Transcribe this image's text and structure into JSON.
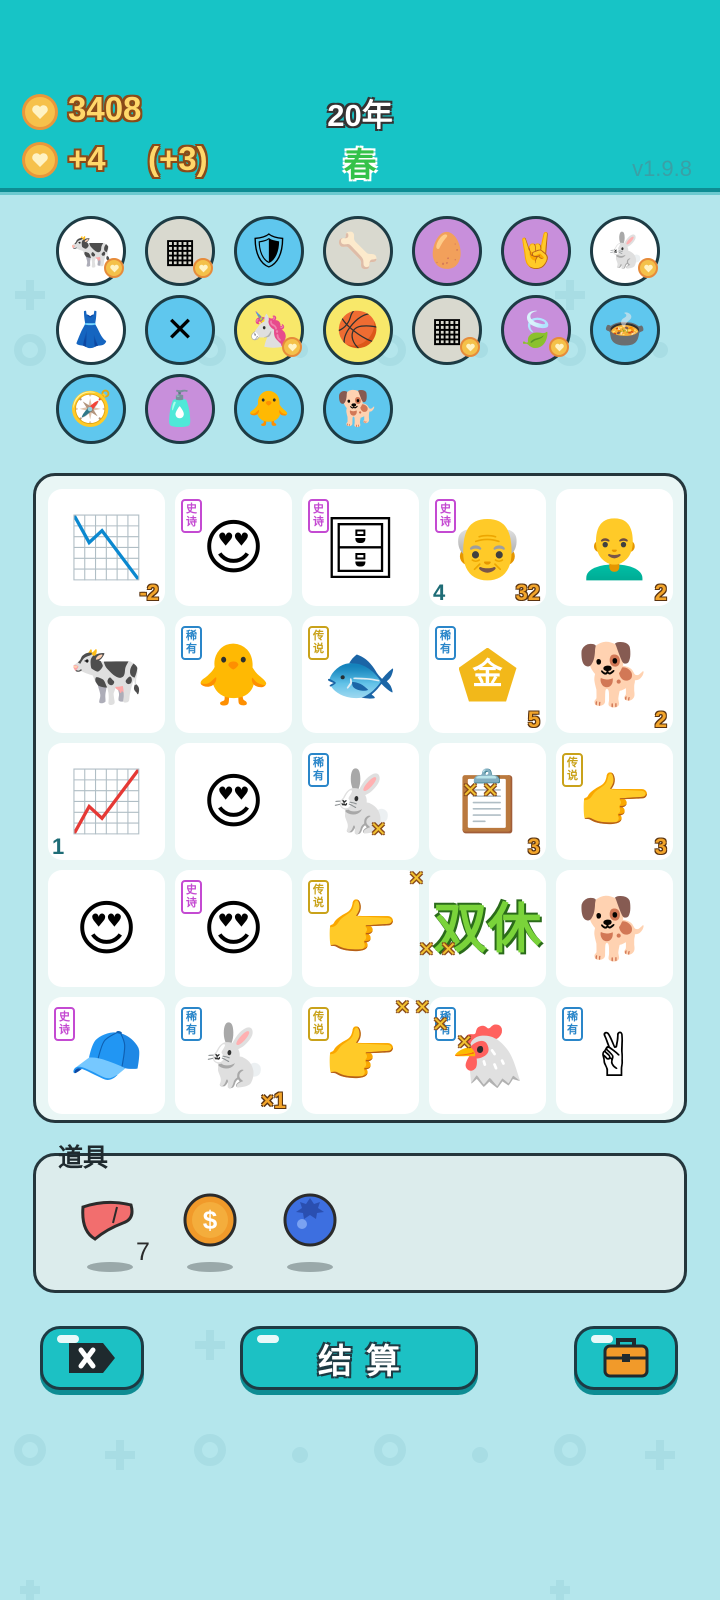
{
  "header": {
    "coins": "3408",
    "coin_gain": "+4",
    "coin_bonus": "(+3)",
    "year": "20年",
    "season": "春",
    "version": "v1.9.8"
  },
  "colors": {
    "header_bg": "#17c4c6",
    "page_bg": "#b4e6ec",
    "coin_text": "#ffd86a",
    "season_text": "#34c24a",
    "epic": "#c44ad2",
    "rare": "#2a86c9",
    "legend": "#c9a21a"
  },
  "inventory": [
    {
      "name": "cow-icon",
      "bg": "#ffffff",
      "glyph": "🐄",
      "heart": true
    },
    {
      "name": "sugar-cubes-icon",
      "bg": "#d9d9cf",
      "glyph": "▦",
      "heart": true
    },
    {
      "name": "shield-wrench-icon",
      "bg": "#5fc7ee",
      "glyph": "🛡",
      "heart": false
    },
    {
      "name": "pet-bowl-icon",
      "bg": "#d9d9cf",
      "glyph": "🦴",
      "heart": false
    },
    {
      "name": "egg-icon",
      "bg": "#c88fdb",
      "glyph": "🥚",
      "heart": false
    },
    {
      "name": "rock-hand-icon",
      "bg": "#c88fdb",
      "glyph": "🤘",
      "heart": false
    },
    {
      "name": "rabbit-icon",
      "bg": "#ffffff",
      "glyph": "🐇",
      "heart": true
    },
    {
      "name": "skirt-icon",
      "bg": "#ffffff",
      "glyph": "👗",
      "heart": false
    },
    {
      "name": "breadsticks-icon",
      "bg": "#5fc7ee",
      "glyph": "✕",
      "heart": false
    },
    {
      "name": "unicorn-icon",
      "bg": "#f8e86a",
      "glyph": "🦄",
      "heart": true
    },
    {
      "name": "basketballs-icon",
      "bg": "#f8e86a",
      "glyph": "🏀",
      "heart": false
    },
    {
      "name": "sugar-cubes-icon",
      "bg": "#d9d9cf",
      "glyph": "▦",
      "heart": true
    },
    {
      "name": "leaf-icon",
      "bg": "#c88fdb",
      "glyph": "🍃",
      "heart": true
    },
    {
      "name": "duck-pot-icon",
      "bg": "#5fc7ee",
      "glyph": "🍲",
      "heart": false
    },
    {
      "name": "compass-icon",
      "bg": "#5fc7ee",
      "glyph": "🧭",
      "heart": false
    },
    {
      "name": "spray-bottle-icon",
      "bg": "#c88fdb",
      "glyph": "🧴",
      "heart": false
    },
    {
      "name": "chick-egg-icon",
      "bg": "#5fc7ee",
      "glyph": "🐥",
      "heart": false
    },
    {
      "name": "cool-dog-icon",
      "bg": "#5fc7ee",
      "glyph": "🐕",
      "heart": false
    }
  ],
  "board": [
    {
      "name": "falling-chart-icon",
      "glyph": "📉",
      "tag": "",
      "tag_type": "",
      "num_br": "-2",
      "num_bl": ""
    },
    {
      "name": "heart-eyes-girl-icon",
      "glyph": "😍",
      "tag": "史诗",
      "tag_type": "epic",
      "num_br": "",
      "num_bl": ""
    },
    {
      "name": "server-rack-icon",
      "glyph": "🗄",
      "tag": "史诗",
      "tag_type": "epic",
      "num_br": "",
      "num_bl": ""
    },
    {
      "name": "grandpa-glasses-icon",
      "glyph": "👴",
      "tag": "史诗",
      "tag_type": "epic",
      "num_br": "32",
      "num_bl": "4"
    },
    {
      "name": "bald-man-glasses-icon",
      "glyph": "👨‍🦲",
      "tag": "",
      "tag_type": "",
      "num_br": "2",
      "num_bl": ""
    },
    {
      "name": "cow-icon",
      "glyph": "🐄",
      "tag": "",
      "tag_type": "",
      "num_br": "",
      "num_bl": ""
    },
    {
      "name": "chick-icon",
      "glyph": "🐥",
      "tag": "稀有",
      "tag_type": "rare",
      "num_br": "",
      "num_bl": ""
    },
    {
      "name": "koi-fish-icon",
      "glyph": "🐟",
      "tag": "传说",
      "tag_type": "legend",
      "num_br": "",
      "num_bl": ""
    },
    {
      "name": "gold-badge-icon",
      "glyph": "金",
      "tag": "稀有",
      "tag_type": "rare",
      "num_br": "5",
      "num_bl": ""
    },
    {
      "name": "husky-icon",
      "glyph": "🐕",
      "tag": "",
      "tag_type": "",
      "num_br": "2",
      "num_bl": ""
    },
    {
      "name": "rising-chart-icon",
      "glyph": "📈",
      "tag": "",
      "tag_type": "",
      "num_br": "",
      "num_bl": "1"
    },
    {
      "name": "heart-eyes-boy-icon",
      "glyph": "😍",
      "tag": "",
      "tag_type": "",
      "num_br": "",
      "num_bl": ""
    },
    {
      "name": "rabbit-icon",
      "glyph": "🐇",
      "tag": "稀有",
      "tag_type": "rare",
      "num_br": "",
      "num_bl": ""
    },
    {
      "name": "ctrl-c-ctrl-v-icon",
      "glyph": "📋",
      "tag": "",
      "tag_type": "",
      "num_br": "3",
      "num_bl": ""
    },
    {
      "name": "pointing-hand-icon",
      "glyph": "👉",
      "tag": "传说",
      "tag_type": "legend",
      "num_br": "3",
      "num_bl": ""
    },
    {
      "name": "heart-eyes-boy-icon",
      "glyph": "😍",
      "tag": "",
      "tag_type": "",
      "num_br": "",
      "num_bl": ""
    },
    {
      "name": "heart-eyes-girl-icon",
      "glyph": "😍",
      "tag": "史诗",
      "tag_type": "epic",
      "num_br": "",
      "num_bl": ""
    },
    {
      "name": "pointing-hand-icon",
      "glyph": "👉",
      "tag": "传说",
      "tag_type": "legend",
      "num_br": "",
      "num_bl": ""
    },
    {
      "name": "double-rest-icon",
      "glyph": "双休",
      "tag": "",
      "tag_type": "",
      "num_br": "",
      "num_bl": ""
    },
    {
      "name": "husky-icon",
      "glyph": "🐕",
      "tag": "",
      "tag_type": "",
      "num_br": "",
      "num_bl": ""
    },
    {
      "name": "red-cap-boy-icon",
      "glyph": "🧢",
      "tag": "史诗",
      "tag_type": "epic",
      "num_br": "",
      "num_bl": ""
    },
    {
      "name": "rabbit-icon",
      "glyph": "🐇",
      "tag": "稀有",
      "tag_type": "rare",
      "num_br": "×1",
      "num_bl": ""
    },
    {
      "name": "pointing-hand-icon",
      "glyph": "👉",
      "tag": "传说",
      "tag_type": "legend",
      "num_br": "",
      "num_bl": ""
    },
    {
      "name": "chicken-icon",
      "glyph": "🐔",
      "tag": "稀有",
      "tag_type": "rare",
      "num_br": "",
      "num_bl": ""
    },
    {
      "name": "two-fingers-icon",
      "glyph": "✌",
      "tag": "稀有",
      "tag_type": "rare",
      "num_br": "",
      "num_bl": ""
    }
  ],
  "items": {
    "title": "道具",
    "list": [
      {
        "name": "liver-icon",
        "count": "7"
      },
      {
        "name": "dollar-coin-icon",
        "count": ""
      },
      {
        "name": "blueberry-icon",
        "count": ""
      }
    ]
  },
  "buttons": {
    "settle_label": "结算"
  }
}
